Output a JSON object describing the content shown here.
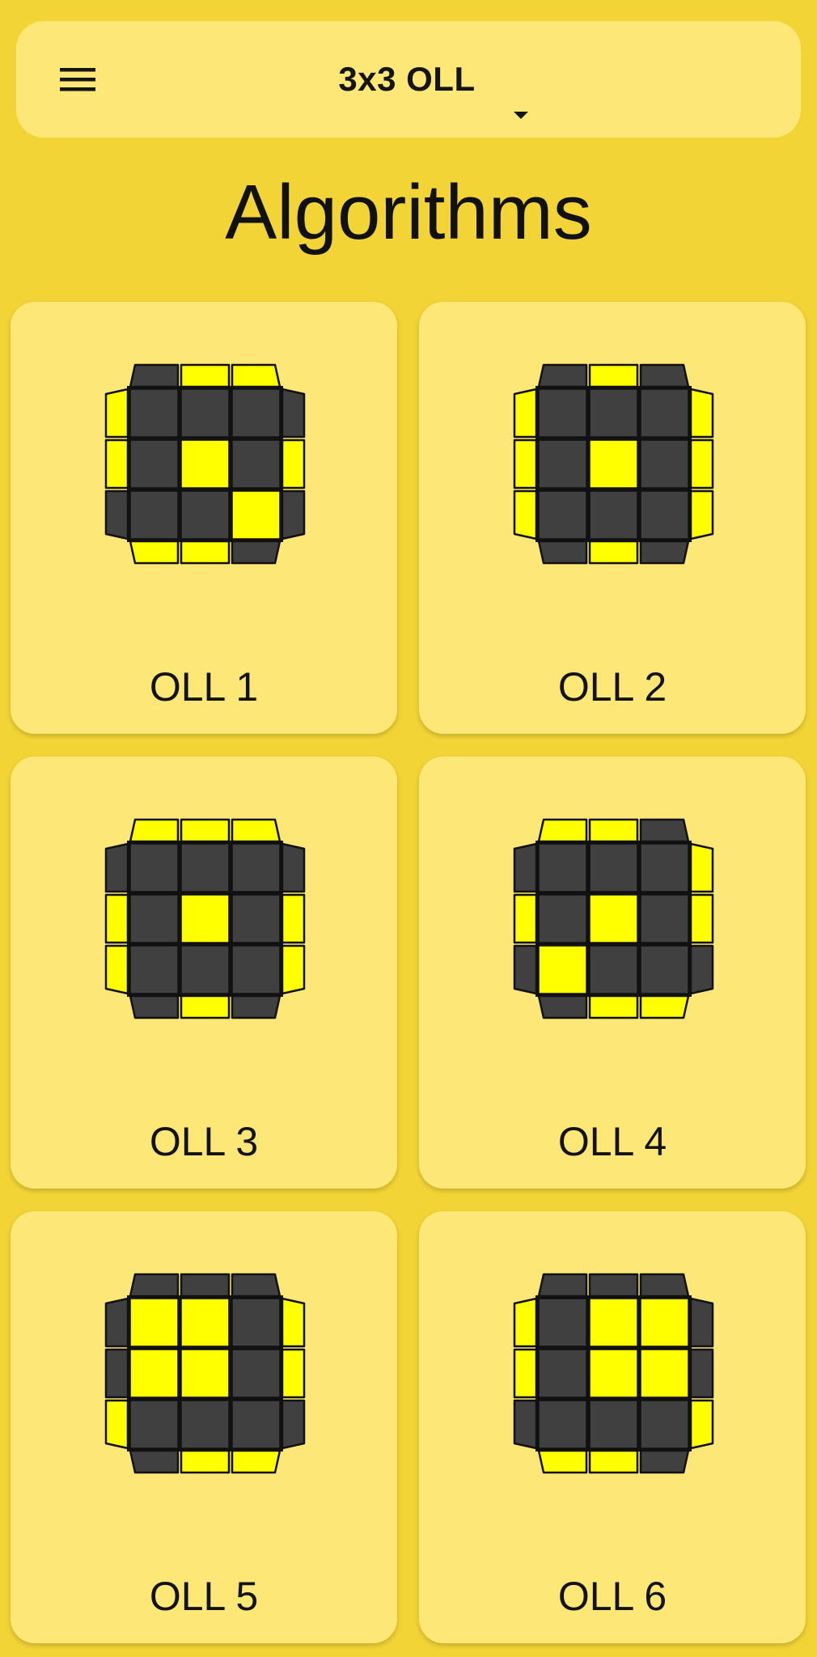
{
  "header": {
    "title": "3x3 OLL",
    "menu_icon": "hamburger-menu-icon",
    "dropdown_icon": "caret-down-icon"
  },
  "page": {
    "heading": "Algorithms"
  },
  "colors": {
    "background": "#f2d436",
    "card": "#fde776",
    "sticker_yellow": "#ffff00",
    "sticker_dark": "#404040",
    "outline": "#111111"
  },
  "cases": [
    {
      "label": "OLL 1",
      "center": [
        0,
        0,
        0,
        0,
        1,
        0,
        0,
        0,
        1
      ],
      "top": [
        0,
        1,
        1
      ],
      "bottom": [
        1,
        1,
        0
      ],
      "left": [
        1,
        1,
        0
      ],
      "right": [
        0,
        1,
        0
      ]
    },
    {
      "label": "OLL 2",
      "center": [
        0,
        0,
        0,
        0,
        1,
        0,
        0,
        0,
        0
      ],
      "top": [
        0,
        1,
        0
      ],
      "bottom": [
        0,
        1,
        0
      ],
      "left": [
        1,
        1,
        1
      ],
      "right": [
        1,
        1,
        1
      ]
    },
    {
      "label": "OLL 3",
      "center": [
        0,
        0,
        0,
        0,
        1,
        0,
        0,
        0,
        0
      ],
      "top": [
        1,
        1,
        1
      ],
      "bottom": [
        0,
        1,
        0
      ],
      "left": [
        0,
        1,
        1
      ],
      "right": [
        0,
        1,
        1
      ]
    },
    {
      "label": "OLL 4",
      "center": [
        0,
        0,
        0,
        0,
        1,
        0,
        1,
        0,
        0
      ],
      "top": [
        1,
        1,
        0
      ],
      "bottom": [
        0,
        1,
        1
      ],
      "left": [
        0,
        1,
        0
      ],
      "right": [
        1,
        1,
        0
      ]
    },
    {
      "label": "OLL 5",
      "center": [
        1,
        1,
        0,
        1,
        1,
        0,
        0,
        0,
        0
      ],
      "top": [
        0,
        0,
        0
      ],
      "bottom": [
        0,
        1,
        1
      ],
      "left": [
        0,
        0,
        1
      ],
      "right": [
        1,
        1,
        0
      ]
    },
    {
      "label": "OLL 6",
      "center": [
        0,
        1,
        1,
        0,
        1,
        1,
        0,
        0,
        0
      ],
      "top": [
        0,
        0,
        0
      ],
      "bottom": [
        1,
        1,
        0
      ],
      "left": [
        1,
        1,
        0
      ],
      "right": [
        0,
        0,
        1
      ]
    }
  ]
}
